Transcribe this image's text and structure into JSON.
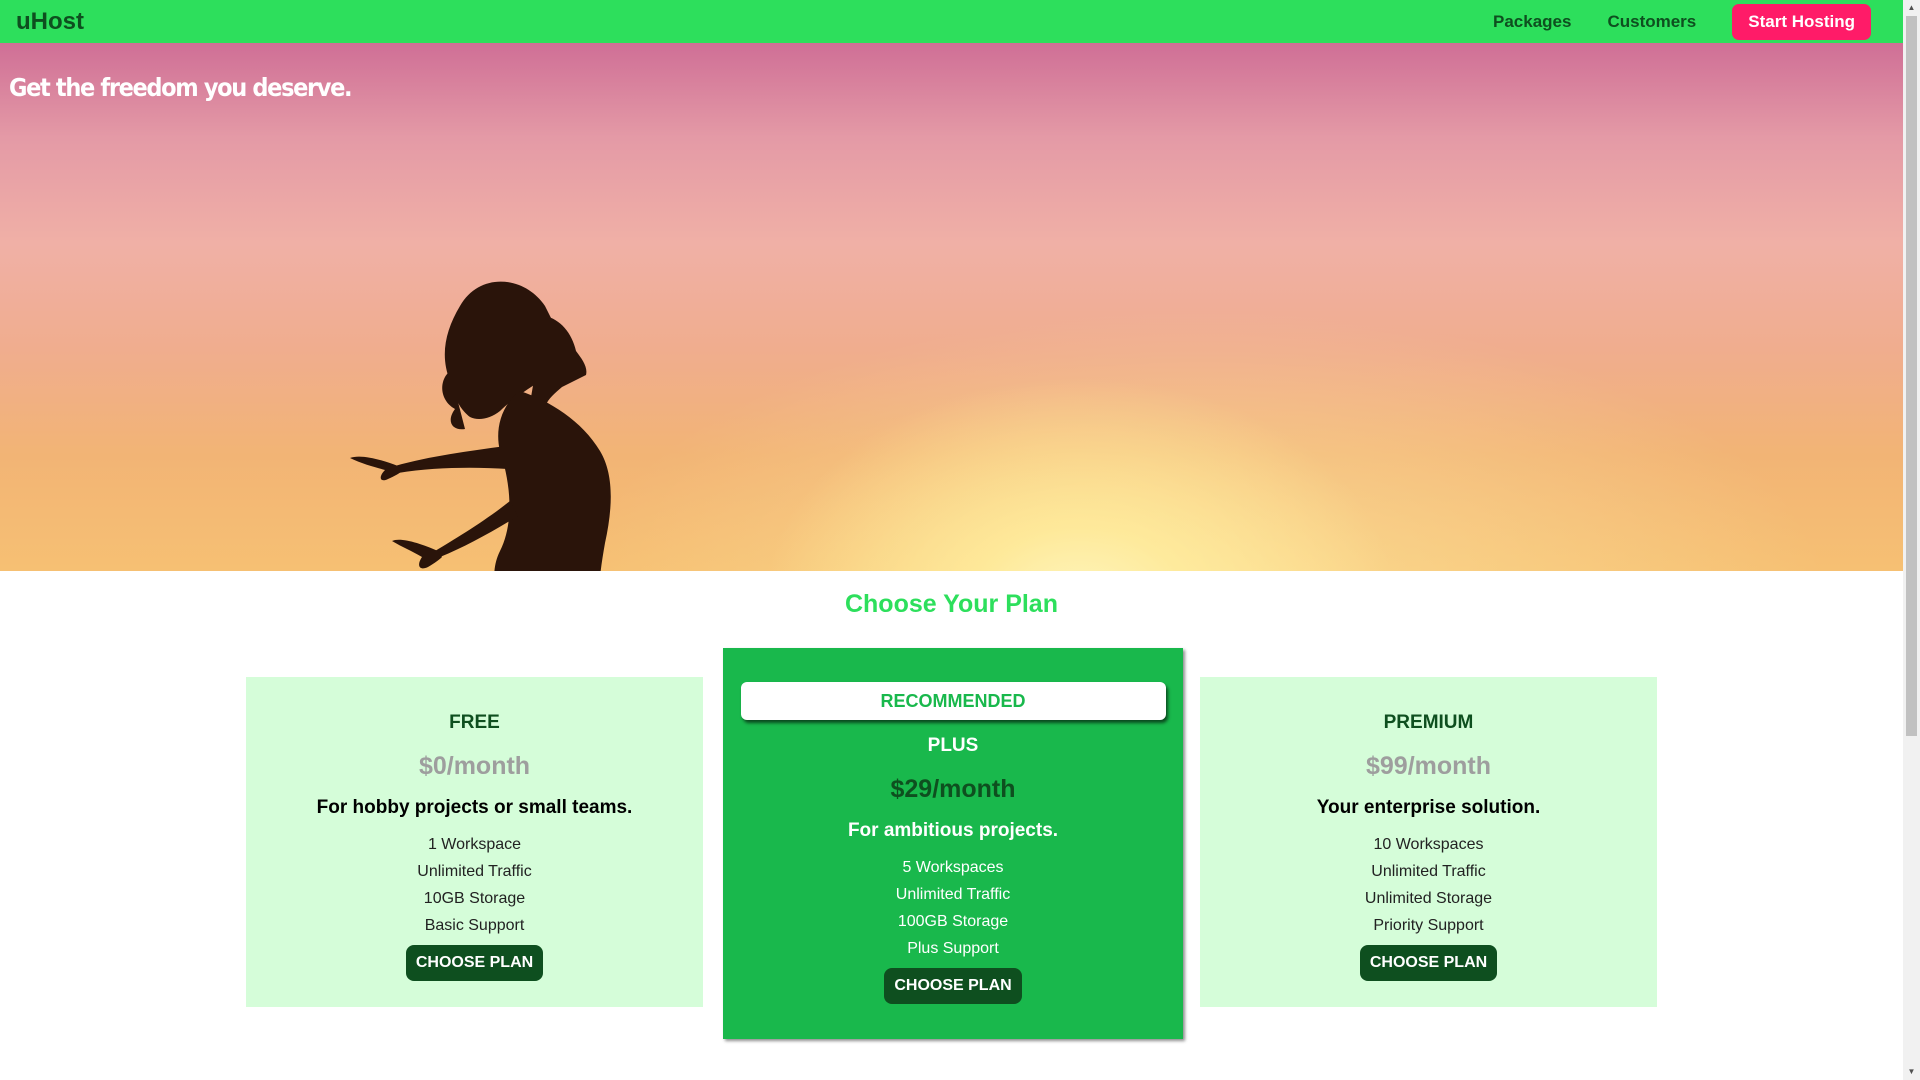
{
  "header": {
    "brand": "uHost",
    "nav": [
      "Packages",
      "Customers"
    ],
    "cta": "Start Hosting"
  },
  "hero": {
    "title": "Get the freedom you deserve."
  },
  "plans_section": {
    "title": "Choose Your Plan",
    "plans": [
      {
        "name": "FREE",
        "price": "$0/month",
        "description": "For hobby projects or small teams.",
        "features": [
          "1 Workspace",
          "Unlimited Traffic",
          "10GB Storage",
          "Basic Support"
        ],
        "button": "CHOOSE PLAN"
      },
      {
        "badge": "RECOMMENDED",
        "name": "PLUS",
        "price": "$29/month",
        "description": "For ambitious projects.",
        "features": [
          "5 Workspaces",
          "Unlimited Traffic",
          "100GB Storage",
          "Plus Support"
        ],
        "button": "CHOOSE PLAN"
      },
      {
        "name": "PREMIUM",
        "price": "$99/month",
        "description": "Your enterprise solution.",
        "features": [
          "10 Workspaces",
          "Unlimited Traffic",
          "Unlimited Storage",
          "Priority Support"
        ],
        "button": "CHOOSE PLAN"
      }
    ]
  },
  "colors": {
    "header_bg": "#2ddf5c",
    "cta_bg": "#ff1b68",
    "plan_card_bg": "#d5fdd9",
    "recommended_bg": "#19b84c",
    "dark_green": "#0e4f1f"
  },
  "icons": {
    "scroll_up": "triangle-up-icon",
    "scroll_down": "triangle-down-icon"
  }
}
